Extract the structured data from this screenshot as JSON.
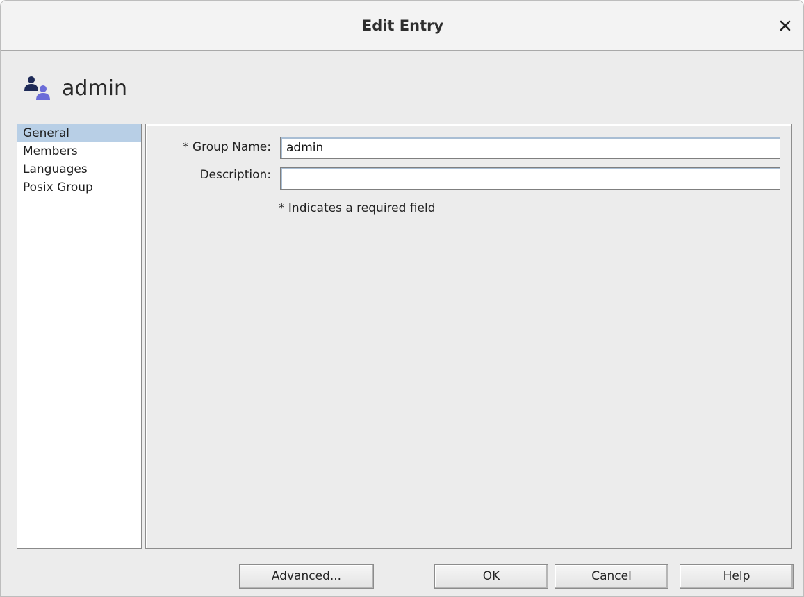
{
  "window": {
    "title": "Edit Entry",
    "close_glyph": "×"
  },
  "header": {
    "icon": "group-icon",
    "title": "admin"
  },
  "nav": {
    "items": [
      {
        "label": "General",
        "selected": true
      },
      {
        "label": "Members",
        "selected": false
      },
      {
        "label": "Languages",
        "selected": false
      },
      {
        "label": "Posix Group",
        "selected": false
      }
    ]
  },
  "form": {
    "group_name_label": "* Group Name:",
    "group_name_value": "admin",
    "description_label": "Description:",
    "description_value": "",
    "required_note": "* Indicates a required field"
  },
  "buttons": {
    "advanced": "Advanced...",
    "ok": "OK",
    "cancel": "Cancel",
    "help": "Help"
  },
  "colors": {
    "selection": "#b8cfe6",
    "icon_dark": "#1e2a57",
    "icon_light": "#6b6cd8"
  }
}
